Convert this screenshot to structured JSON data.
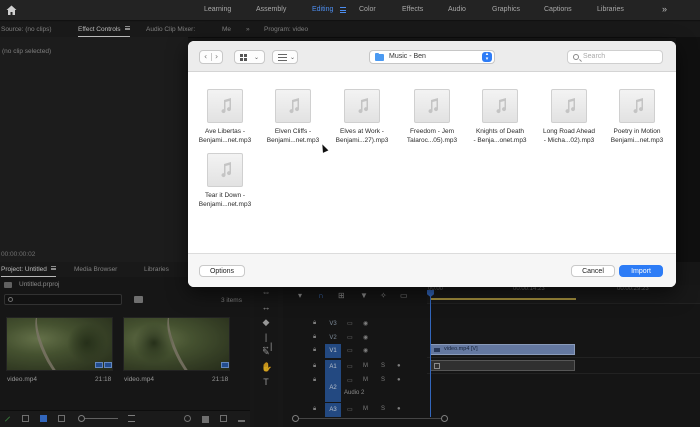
{
  "workspace_tabs": [
    {
      "label": "Learning"
    },
    {
      "label": "Assembly"
    },
    {
      "label": "Editing"
    },
    {
      "label": "Color"
    },
    {
      "label": "Effects"
    },
    {
      "label": "Audio"
    },
    {
      "label": "Graphics"
    },
    {
      "label": "Captions"
    },
    {
      "label": "Libraries"
    }
  ],
  "active_workspace": "Editing",
  "more_icon": "»",
  "source_panel": {
    "tabs": [
      "Source: (no clips)",
      "Effect Controls",
      "Audio Clip Mixer:",
      "Me"
    ],
    "program_tab": "Program: video",
    "no_clip_text": "(no clip selected)",
    "timecode": "00:00:00:02"
  },
  "project_panel": {
    "tabs": [
      "Project: Untitled",
      "Media Browser",
      "Libraries"
    ],
    "file_name": "Untitled.prproj",
    "item_count": "3 items",
    "items": [
      {
        "name": "video.mp4",
        "duration": "21:18"
      },
      {
        "name": "video.mp4",
        "duration": "21:18"
      }
    ]
  },
  "timeline": {
    "ruler_labels": [
      "00:00",
      "00:00:14:23",
      "00:00:29:23"
    ],
    "tracks": [
      {
        "label": "V3",
        "on": false
      },
      {
        "label": "V2",
        "on": false
      },
      {
        "label": "V1",
        "on": true
      },
      {
        "label": "A1",
        "on": true
      },
      {
        "label": "A2",
        "on": true
      },
      {
        "label": "A3",
        "on": true
      }
    ],
    "track_buttons": {
      "mute": "M",
      "solo": "S"
    },
    "audio2_name": "Audio 2",
    "video_clip_label": "video.mp4 [V]"
  },
  "dialog": {
    "location": "Music - Ben",
    "search_placeholder": "Search",
    "files": [
      {
        "line1": "Ave Libertas -",
        "line2": "Benjami...net.mp3"
      },
      {
        "line1": "Elven Cliffs -",
        "line2": "Benjami...net.mp3"
      },
      {
        "line1": "Elves at Work -",
        "line2": "Benjami...27).mp3"
      },
      {
        "line1": "Freedom - Jem",
        "line2": "Talaroc...05).mp3"
      },
      {
        "line1": "Knights of Death",
        "line2": "- Benja...onet.mp3"
      },
      {
        "line1": "Long Road Ahead",
        "line2": "- Micha...02).mp3"
      },
      {
        "line1": "Poetry in Motion",
        "line2": "Benjami...net.mp3"
      },
      {
        "line1": "Tear it Down -",
        "line2": "Benjami...net.mp3"
      }
    ],
    "options_label": "Options",
    "cancel_label": "Cancel",
    "import_label": "Import"
  },
  "colors": {
    "accent": "#2d7cf6",
    "premiere_blue": "#4d8ef0",
    "clip": "#7a93c4"
  }
}
